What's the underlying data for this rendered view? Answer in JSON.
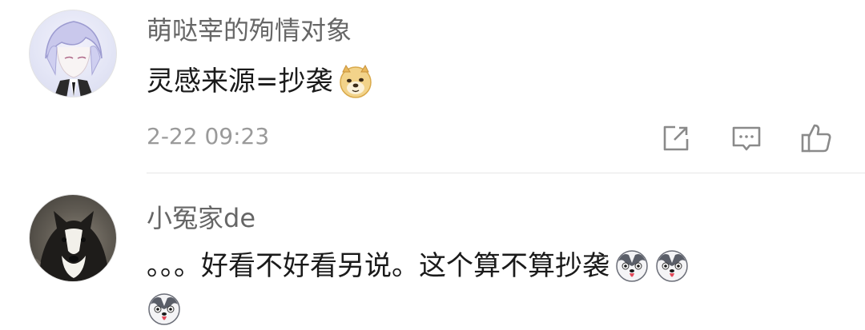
{
  "comments": [
    {
      "username": "萌哒宰的殉情对象",
      "text": "灵感来源=抄袭",
      "emojis": [
        "doge-emoji"
      ],
      "timestamp": "2-22 09:23",
      "actions": [
        "share-icon",
        "comment-icon",
        "like-icon"
      ]
    },
    {
      "username": "小冤家de",
      "text": "。。。好看不好看另说。这个算不算抄袭",
      "emojis": [
        "husky-emoji",
        "husky-emoji",
        "husky-emoji"
      ]
    }
  ],
  "colors": {
    "username": "#666666",
    "text": "#1a1a1a",
    "timestamp": "#9a9a9a",
    "icon": "#8a8a8a",
    "divider": "#e6e6e6"
  }
}
